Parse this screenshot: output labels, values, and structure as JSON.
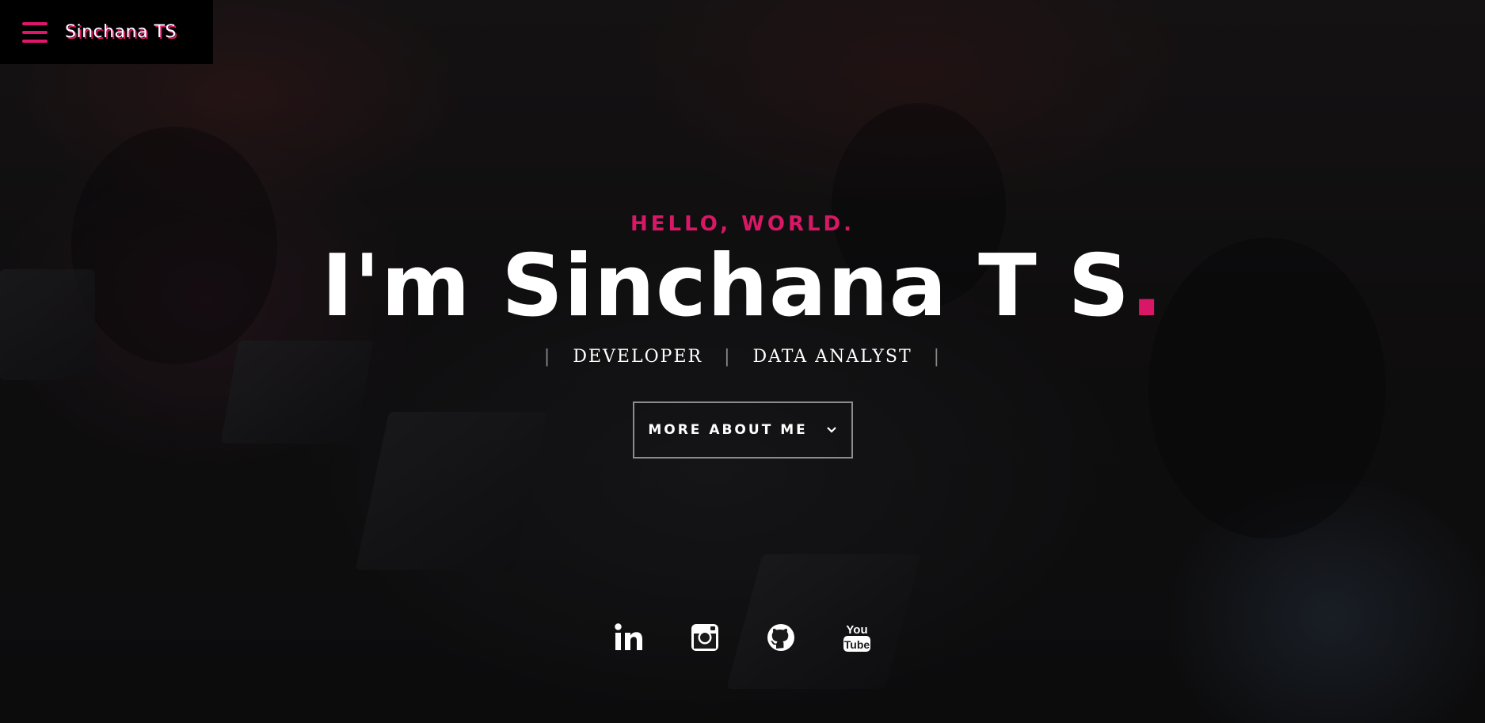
{
  "header": {
    "brand": "Sinchana TS",
    "menu_icon": "hamburger-menu-icon"
  },
  "hero": {
    "greeting": "HELLO, WORLD.",
    "headline": "I'm Sinchana T S",
    "headline_dot": ".",
    "roles": [
      "DEVELOPER",
      "DATA ANALYST"
    ],
    "separator": "|",
    "cta_label": "MORE ABOUT ME",
    "cta_icon": "chevron-down-icon"
  },
  "social": [
    {
      "name": "linkedin",
      "icon": "linkedin-icon"
    },
    {
      "name": "instagram",
      "icon": "instagram-icon"
    },
    {
      "name": "github",
      "icon": "github-icon"
    },
    {
      "name": "youtube",
      "icon": "youtube-icon",
      "text_top": "You",
      "text_bottom": "Tube"
    }
  ],
  "colors": {
    "accent": "#d81866",
    "topbar_bg": "#000000",
    "text": "#ffffff"
  }
}
